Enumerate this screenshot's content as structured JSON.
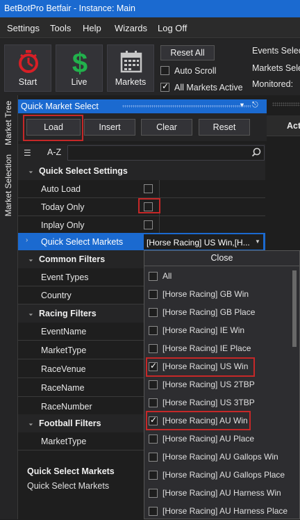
{
  "window": {
    "title": "BetBotPro Betfair - Instance: Main"
  },
  "menu": [
    "Settings",
    "Tools",
    "Help",
    "Wizards",
    "Log Off"
  ],
  "toolbar": {
    "start": "Start",
    "live": "Live",
    "markets": "Markets",
    "reset_all": "Reset All",
    "auto_scroll": "Auto Scroll",
    "all_markets_active": "All Markets Active",
    "events_selected": "Events Selec",
    "markets_selected": "Markets Sele",
    "monitored": "Monitored:"
  },
  "side_tabs": [
    "Market Tree",
    "Market Selection"
  ],
  "panel": {
    "title": "Quick Market Select",
    "buttons": {
      "load": "Load",
      "insert": "Insert",
      "clear": "Clear",
      "reset": "Reset"
    },
    "sort_az": "A-Z",
    "search_placeholder": ""
  },
  "property_grid": {
    "quick_select_settings": "Quick Select Settings",
    "auto_load": "Auto Load",
    "today_only": "Today Only",
    "inplay_only": "Inplay Only",
    "quick_select_markets": "Quick Select Markets",
    "quick_select_markets_value": "[Horse Racing] US Win,[H...",
    "common_filters": "Common Filters",
    "event_types": "Event Types",
    "country": "Country",
    "racing_filters": "Racing Filters",
    "event_name": "EventName",
    "market_type": "MarketType",
    "race_venue": "RaceVenue",
    "race_name": "RaceName",
    "race_number": "RaceNumber",
    "football_filters": "Football Filters",
    "football_market_type": "MarketType"
  },
  "description": {
    "title": "Quick Select Markets",
    "text": "Quick Select Markets"
  },
  "dropdown": {
    "close": "Close",
    "items": [
      {
        "label": "All",
        "checked": false
      },
      {
        "label": "[Horse Racing] GB Win",
        "checked": false
      },
      {
        "label": "[Horse Racing] GB Place",
        "checked": false
      },
      {
        "label": "[Horse Racing] IE Win",
        "checked": false
      },
      {
        "label": "[Horse Racing] IE Place",
        "checked": false
      },
      {
        "label": "[Horse Racing] US Win",
        "checked": true
      },
      {
        "label": "[Horse Racing] US 2TBP",
        "checked": false
      },
      {
        "label": "[Horse Racing] US 3TBP",
        "checked": false
      },
      {
        "label": "[Horse Racing] AU Win",
        "checked": true
      },
      {
        "label": "[Horse Racing] AU Place",
        "checked": false
      },
      {
        "label": "[Horse Racing] AU Gallops Win",
        "checked": false
      },
      {
        "label": "[Horse Racing] AU Gallops Place",
        "checked": false
      },
      {
        "label": "[Horse Racing] AU Harness Win",
        "checked": false
      },
      {
        "label": "[Horse Racing] AU Harness Place",
        "checked": false
      }
    ]
  },
  "right_grid": {
    "header": "Act"
  },
  "colors": {
    "accent": "#1b6ad0",
    "highlight": "#c62828",
    "start_icon": "#d81f26",
    "live_icon": "#22b14c"
  }
}
